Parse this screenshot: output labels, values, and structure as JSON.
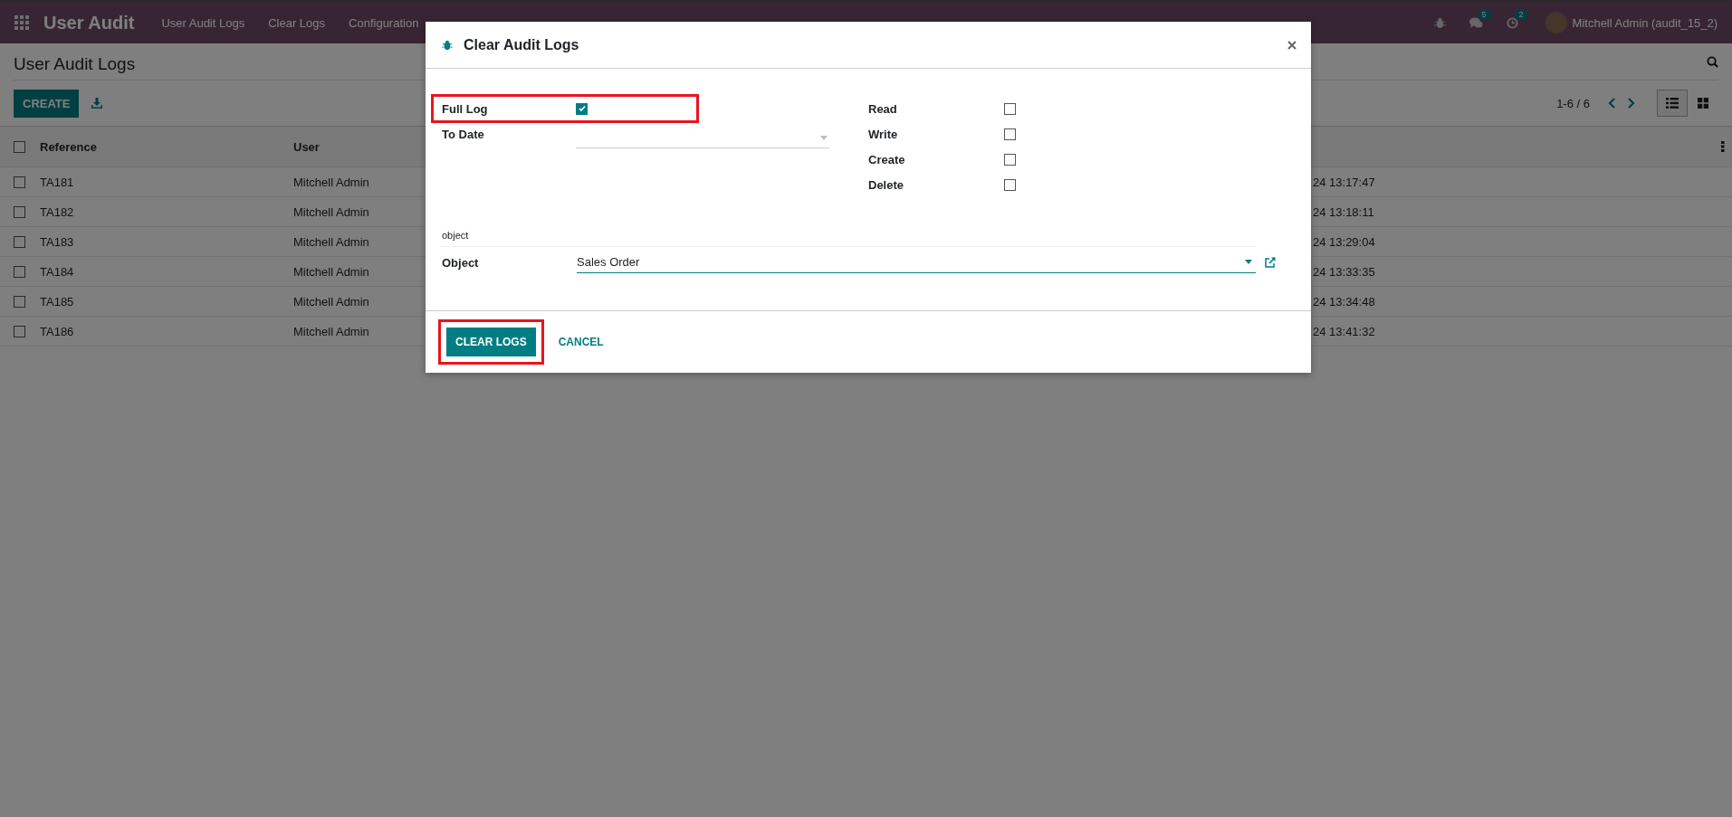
{
  "navbar": {
    "app_title": "User Audit",
    "menu": [
      "User Audit Logs",
      "Clear Logs",
      "Configuration"
    ],
    "systray": [
      {
        "kind": "debug"
      },
      {
        "kind": "messages",
        "badge": "5"
      },
      {
        "kind": "activities",
        "badge": "2"
      }
    ],
    "user": "Mitchell Admin (audit_15_2)"
  },
  "page": {
    "title": "User Audit Logs",
    "create_button": "CREATE",
    "pager": "1-6 / 6",
    "views": [
      {
        "kind": "list",
        "selected": true
      },
      {
        "kind": "kanban",
        "selected": false
      }
    ]
  },
  "table": {
    "select_all_selected": false,
    "columns": [
      "Reference",
      "User"
    ],
    "rows": [
      {
        "reference": "TA181",
        "user": "Mitchell Admin",
        "column_3": "24 13:17:47",
        "selected": false
      },
      {
        "reference": "TA182",
        "user": "Mitchell Admin",
        "column_3": "24 13:18:11",
        "selected": false
      },
      {
        "reference": "TA183",
        "user": "Mitchell Admin",
        "column_3": "24 13:29:04",
        "selected": false
      },
      {
        "reference": "TA184",
        "user": "Mitchell Admin",
        "column_3": "24 13:33:35",
        "selected": false
      },
      {
        "reference": "TA185",
        "user": "Mitchell Admin",
        "column_3": "24 13:34:48",
        "selected": false
      },
      {
        "reference": "TA186",
        "user": "Mitchell Admin",
        "column_3": "24 13:41:32",
        "selected": false
      }
    ]
  },
  "dialog": {
    "title": "Clear Audit Logs",
    "full_log": {
      "label": "Full Log",
      "checked": true,
      "highlighted": true
    },
    "to_date": {
      "label": "To Date"
    },
    "operations": [
      {
        "label": "Read",
        "checked": false
      },
      {
        "label": "Write",
        "checked": false
      },
      {
        "label": "Create",
        "checked": false
      },
      {
        "label": "Delete",
        "checked": false
      }
    ],
    "section_label": "object",
    "object": {
      "label": "Object",
      "value": "Sales Order"
    },
    "buttons": [
      {
        "label": "CLEAR LOGS",
        "kind": "primary",
        "highlighted": true
      },
      {
        "label": "CANCEL",
        "kind": "link",
        "highlighted": false
      }
    ]
  }
}
